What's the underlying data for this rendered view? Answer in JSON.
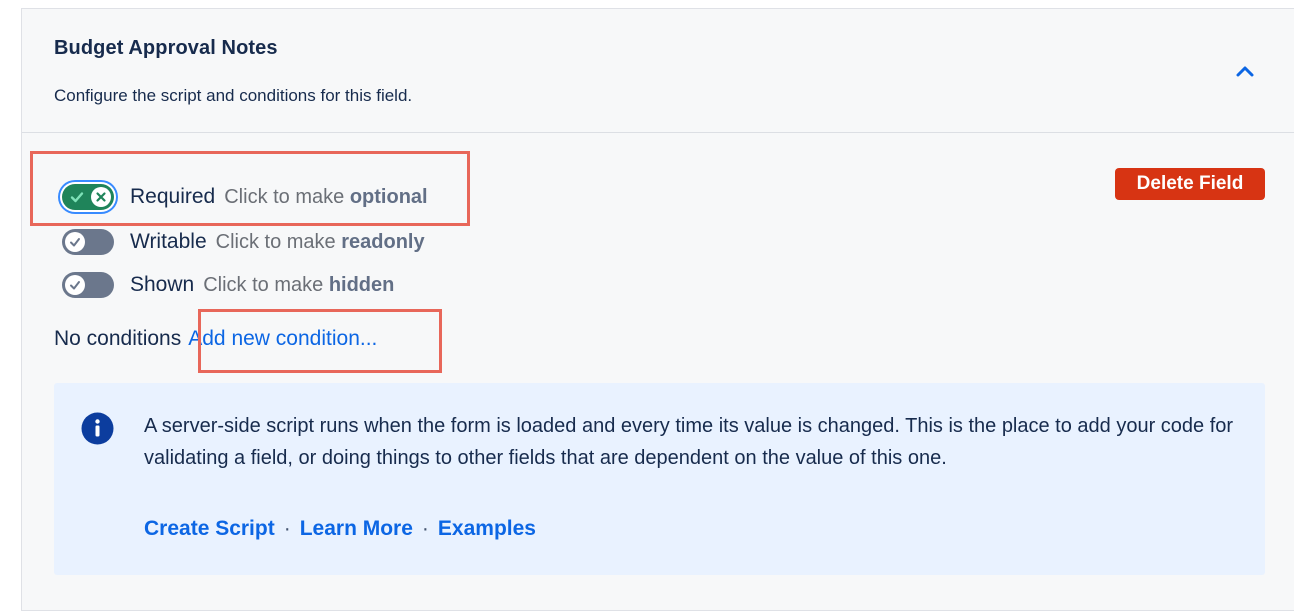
{
  "panel": {
    "title": "Budget Approval Notes",
    "description": "Configure the script and conditions for this field."
  },
  "toggles": [
    {
      "label": "Required",
      "hint_prefix": "Click to make",
      "hint_bold": "optional",
      "state": "on"
    },
    {
      "label": "Writable",
      "hint_prefix": "Click to make",
      "hint_bold": "readonly",
      "state": "off"
    },
    {
      "label": "Shown",
      "hint_prefix": "Click to make",
      "hint_bold": "hidden",
      "state": "off"
    }
  ],
  "delete_button": {
    "label": "Delete Field"
  },
  "conditions": {
    "status": "No conditions",
    "add_link": "Add new condition..."
  },
  "info": {
    "text": "A server-side script runs when the form is loaded and every time its value is changed. This is the place to add your code for validating a field, or doing things to other fields that are dependent on the value of this one.",
    "links": {
      "create": "Create Script",
      "learn": "Learn More",
      "examples": "Examples",
      "separator": "·"
    }
  },
  "icons": {
    "collapse": "chevron-up-icon",
    "toggle_on": "cross-icon",
    "toggle_off": "check-icon",
    "info": "info-icon"
  },
  "colors": {
    "accent": "#0c66e4",
    "danger": "#d73413",
    "toggle_on": "#1f845a",
    "toggle_off": "#6b778c",
    "info_background": "#e9f2ff",
    "highlight": "#e8675a"
  }
}
